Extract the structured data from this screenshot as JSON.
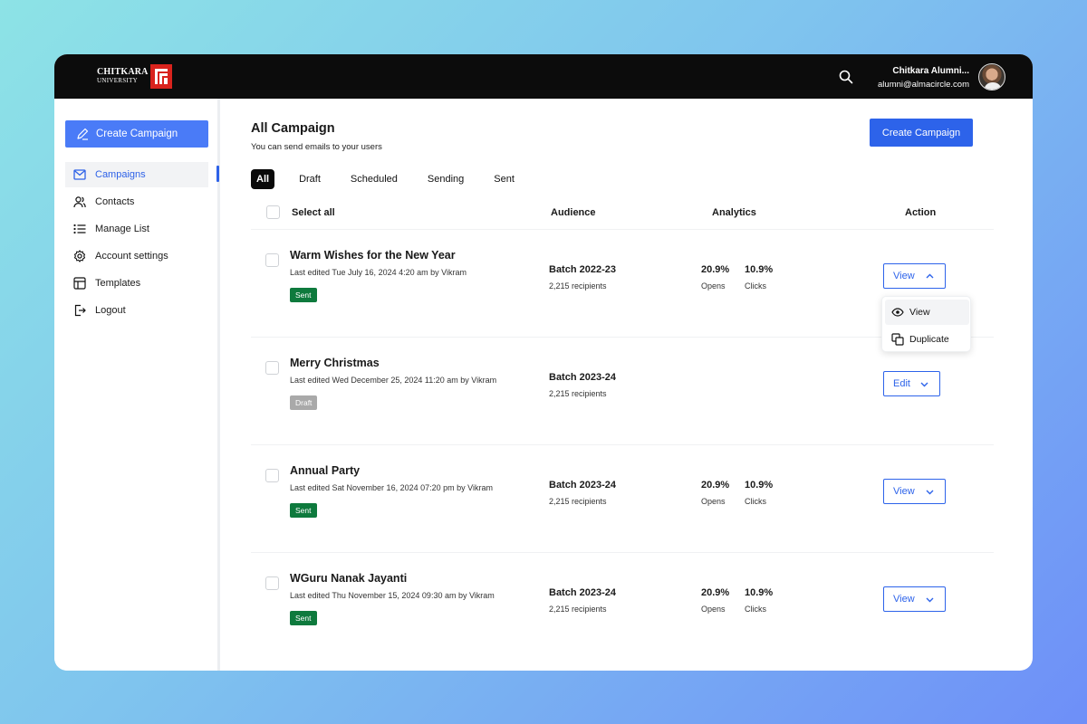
{
  "brand": {
    "line1": "CHITKARA",
    "line2": "UNIVERSITY"
  },
  "user": {
    "name": "Chitkara Alumni...",
    "email": "alumni@almacircle.com"
  },
  "sidebar": {
    "create_label": "Create Campaign",
    "items": [
      {
        "label": "Campaigns",
        "icon": "mail-icon",
        "active": true
      },
      {
        "label": "Contacts",
        "icon": "users-icon"
      },
      {
        "label": "Manage List",
        "icon": "list-icon"
      },
      {
        "label": "Account settings",
        "icon": "gear-icon"
      },
      {
        "label": "Templates",
        "icon": "layout-icon"
      },
      {
        "label": "Logout",
        "icon": "logout-icon"
      }
    ]
  },
  "main": {
    "title": "All Campaign",
    "subtitle": "You can send emails to your users",
    "create_label": "Create Campaign",
    "tabs": [
      "All",
      "Draft",
      "Scheduled",
      "Sending",
      "Sent"
    ],
    "active_tab": "All",
    "columns": {
      "select_all": "Select all",
      "audience": "Audience",
      "analytics": "Analytics",
      "action": "Action"
    }
  },
  "campaigns": [
    {
      "title": "Warm Wishes for the New Year",
      "meta": "Last edited Tue July 16, 2024 4:20 am by Vikram",
      "status": "Sent",
      "audience": "Batch 2022-23",
      "recipients": "2,215 recipients",
      "opens": "20.9%",
      "opens_label": "Opens",
      "clicks": "10.9%",
      "clicks_label": "Clicks",
      "action": "View",
      "expanded": true
    },
    {
      "title": "Merry Christmas",
      "meta": "Last edited Wed December 25, 2024 11:20 am by Vikram",
      "status": "Draft",
      "audience": "Batch 2023-24",
      "recipients": "2,215 recipients",
      "action": "Edit"
    },
    {
      "title": "Annual Party",
      "meta": "Last edited Sat November 16, 2024 07:20 pm by Vikram",
      "status": "Sent",
      "audience": "Batch 2023-24",
      "recipients": "2,215 recipients",
      "opens": "20.9%",
      "opens_label": "Opens",
      "clicks": "10.9%",
      "clicks_label": "Clicks",
      "action": "View"
    },
    {
      "title": "WGuru Nanak Jayanti",
      "meta": "Last edited Thu November 15, 2024 09:30 am by Vikram",
      "status": "Sent",
      "audience": "Batch 2023-24",
      "recipients": "2,215 recipients",
      "opens": "20.9%",
      "opens_label": "Opens",
      "clicks": "10.9%",
      "clicks_label": "Clicks",
      "action": "View"
    }
  ],
  "dropdown": {
    "items": [
      {
        "label": "View",
        "icon": "eye-icon"
      },
      {
        "label": "Duplicate",
        "icon": "copy-icon"
      }
    ]
  },
  "colors": {
    "primary": "#2d63ea",
    "sidebar_button": "#4a7bf7",
    "sent": "#0e7a3d",
    "draft": "#a9a9a9",
    "topbar": "#0c0c0c"
  }
}
